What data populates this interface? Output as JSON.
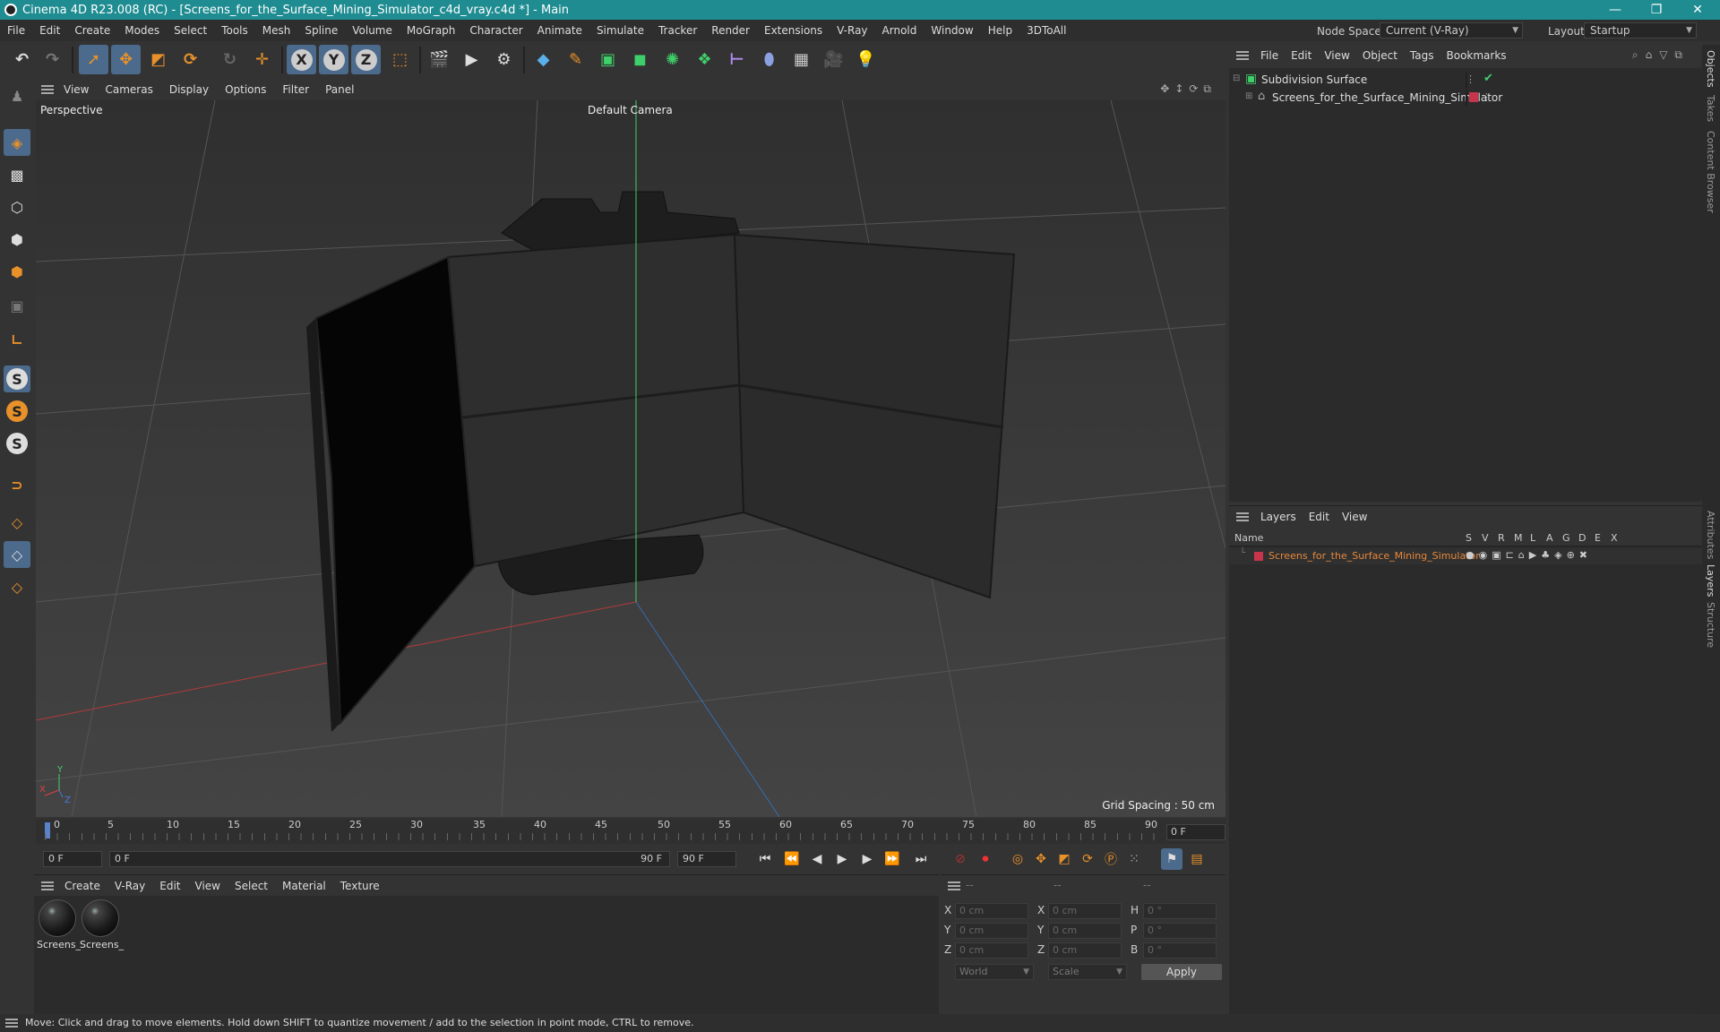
{
  "titlebar": {
    "title": "Cinema 4D R23.008 (RC) - [Screens_for_the_Surface_Mining_Simulator_c4d_vray.c4d *] - Main",
    "minimize": "—",
    "restore": "❐",
    "close": "✕"
  },
  "menubar": {
    "items": [
      "File",
      "Edit",
      "Create",
      "Modes",
      "Select",
      "Tools",
      "Mesh",
      "Spline",
      "Volume",
      "MoGraph",
      "Character",
      "Animate",
      "Simulate",
      "Tracker",
      "Render",
      "Extensions",
      "V-Ray",
      "Arnold",
      "Window",
      "Help",
      "3DToAll"
    ]
  },
  "nodespace": {
    "label": "Node Space:",
    "value": "Current (V-Ray)"
  },
  "layout": {
    "label": "Layout:",
    "value": "Startup"
  },
  "viewport": {
    "menu": [
      "View",
      "Cameras",
      "Display",
      "Options",
      "Filter",
      "Panel"
    ],
    "label": "Perspective",
    "camera": "Default Camera",
    "grid_spacing": "Grid Spacing : 50 cm",
    "axis_x": "X",
    "axis_y": "Y",
    "axis_z": "Z"
  },
  "timeline": {
    "ticks": [
      "0",
      "5",
      "10",
      "15",
      "20",
      "25",
      "30",
      "35",
      "40",
      "45",
      "50",
      "55",
      "60",
      "65",
      "70",
      "75",
      "80",
      "85",
      "90"
    ],
    "current_frame": "0 F",
    "start": "0 F",
    "range_start": "0 F",
    "range_end": "90 F",
    "end": "90 F"
  },
  "material_manager": {
    "menu": [
      "Create",
      "V-Ray",
      "Edit",
      "View",
      "Select",
      "Material",
      "Texture"
    ],
    "materials": [
      "Screens_",
      "Screens_"
    ]
  },
  "coordinates": {
    "header": [
      "--",
      "--",
      "--"
    ],
    "rows": [
      {
        "l1": "X",
        "v1": "0 cm",
        "l2": "X",
        "v2": "0 cm",
        "l3": "H",
        "v3": "0 °"
      },
      {
        "l1": "Y",
        "v1": "0 cm",
        "l2": "Y",
        "v2": "0 cm",
        "l3": "P",
        "v3": "0 °"
      },
      {
        "l1": "Z",
        "v1": "0 cm",
        "l2": "Z",
        "v2": "0 cm",
        "l3": "B",
        "v3": "0 °"
      }
    ],
    "space": "World",
    "mode": "Scale",
    "apply": "Apply"
  },
  "objects": {
    "menu": [
      "File",
      "Edit",
      "View",
      "Object",
      "Tags",
      "Bookmarks"
    ],
    "items": [
      "Subdivision Surface",
      "Screens_for_the_Surface_Mining_Simulator"
    ]
  },
  "layers": {
    "menu": [
      "Layers",
      "Edit",
      "View"
    ],
    "header_name": "Name",
    "columns": [
      "S",
      "V",
      "R",
      "M",
      "L",
      "A",
      "G",
      "D",
      "E",
      "X"
    ],
    "items": [
      "Screens_for_the_Surface_Mining_Simulator"
    ]
  },
  "right_tabs": [
    "Objects",
    "Takes",
    "Content Browser",
    "Attributes",
    "Layers",
    "Structure"
  ],
  "status": "Move: Click and drag to move elements. Hold down SHIFT to quantize movement / add to the selection in point mode, CTRL to remove.",
  "colors": {
    "accent": "#1e8c91",
    "selected": "#4b6a8c",
    "layer": "#c8344b",
    "layer_text": "#e7883b",
    "orange_icon": "#e8912a"
  }
}
